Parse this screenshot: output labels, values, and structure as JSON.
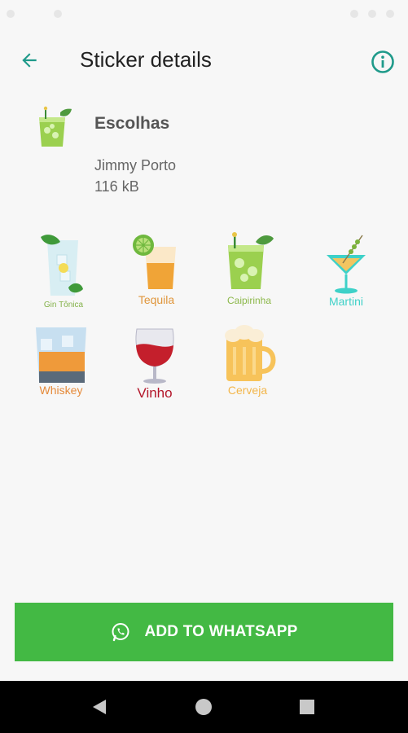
{
  "appbar": {
    "title": "Sticker details",
    "back_icon": "arrow-left-icon",
    "info_icon": "info-icon"
  },
  "pack": {
    "name": "Escolhas",
    "publisher": "Jimmy Porto",
    "size": "116 kB"
  },
  "stickers": [
    {
      "label": "Gin Tônica",
      "label_color": "#84b24a"
    },
    {
      "label": "Tequila",
      "label_color": "#e0963b"
    },
    {
      "label": "Caipirinha",
      "label_color": "#8cb84a"
    },
    {
      "label": "Martini",
      "label_color": "#3ed1c8"
    },
    {
      "label": "Whiskey",
      "label_color": "#e58a3a"
    },
    {
      "label": "Vinho",
      "label_color": "#b3162a"
    },
    {
      "label": "Cerveja",
      "label_color": "#f3b64a"
    }
  ],
  "button": {
    "label": "ADD TO WHATSAPP",
    "icon": "whatsapp-icon",
    "color": "#43b944"
  },
  "colors": {
    "accent": "#1f9a8a"
  },
  "nav": {
    "back_icon": "nav-back-icon",
    "home_icon": "nav-home-icon",
    "recents_icon": "nav-recents-icon"
  }
}
